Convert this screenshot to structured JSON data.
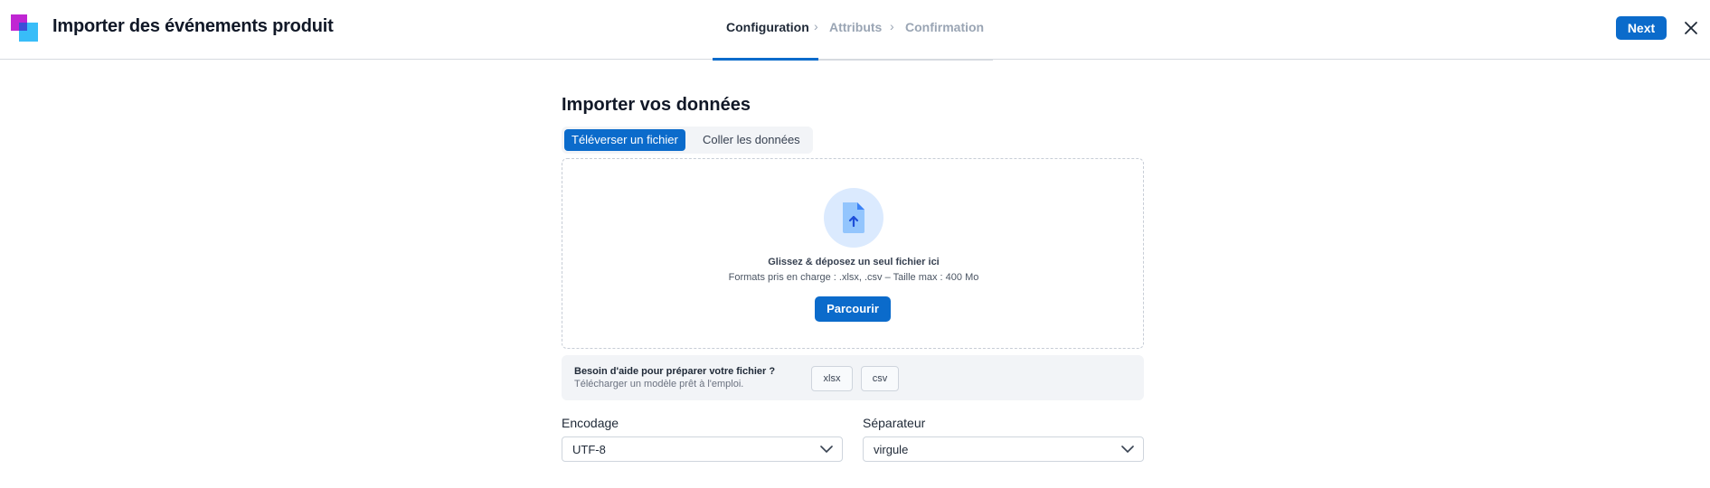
{
  "header": {
    "title": "Importer des événements produit",
    "steps": [
      {
        "label": "Configuration",
        "state": "active"
      },
      {
        "label": "Attributs",
        "state": "inactive"
      },
      {
        "label": "Confirmation",
        "state": "inactive"
      }
    ],
    "next_label": "Next",
    "close_icon": "close-icon"
  },
  "main": {
    "title": "Importer vos données",
    "tabs": [
      {
        "label": "Téléverser un fichier",
        "active": true
      },
      {
        "label": "Coller les données",
        "active": false
      }
    ],
    "dropzone": {
      "icon": "file-upload-icon",
      "title": "Glissez & déposez un seul fichier ici",
      "subtitle": "Formats pris en charge : .xlsx, .csv – Taille max : 400 Mo",
      "browse_label": "Parcourir"
    },
    "help": {
      "title": "Besoin d'aide pour préparer votre fichier ?",
      "subtitle": "Télécharger un modèle prêt à l'emploi.",
      "formats": [
        "xlsx",
        "csv"
      ]
    },
    "encoding": {
      "label": "Encodage",
      "value": "UTF-8"
    },
    "separator": {
      "label": "Séparateur",
      "value": "virgule"
    }
  },
  "colors": {
    "accent": "#0b6bcb",
    "inactive_step": "#9aa5b4",
    "panel_bg": "#f2f4f7"
  }
}
